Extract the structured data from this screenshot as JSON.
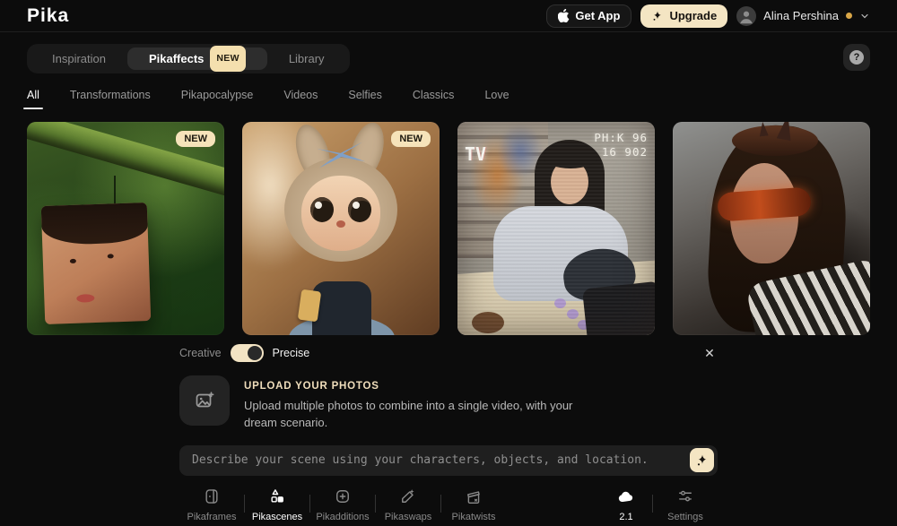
{
  "header": {
    "logo": "Pika",
    "get_app_label": "Get App",
    "upgrade_label": "Upgrade",
    "user_name": "Alina Pershina"
  },
  "tabs": {
    "items": [
      {
        "label": "Inspiration",
        "active": false
      },
      {
        "label": "Pikaffects",
        "badge": "NEW",
        "active": true
      },
      {
        "label": "Library",
        "active": false
      }
    ],
    "help_label": "?"
  },
  "filters": {
    "active": "All",
    "items": [
      "All",
      "Transformations",
      "Pikapocalypse",
      "Videos",
      "Selfies",
      "Classics",
      "Love"
    ]
  },
  "cards": [
    {
      "name": "jungle-face-cube",
      "badge": "NEW"
    },
    {
      "name": "plush-doll",
      "badge": "NEW"
    },
    {
      "name": "vhs-store-scene",
      "overlay_tv": "TV",
      "overlay_time_line1": "PH:K 96",
      "overlay_time_line2": "16 902"
    },
    {
      "name": "masked-warrior"
    }
  ],
  "mode_toggle": {
    "left_label": "Creative",
    "right_label": "Precise",
    "selected": "Precise",
    "close_label": "✕"
  },
  "upload": {
    "title": "UPLOAD YOUR PHOTOS",
    "description": "Upload multiple photos to combine into a single video, with your dream scenario."
  },
  "prompt": {
    "placeholder": "Describe your scene using your characters, objects, and location."
  },
  "bottom_nav": {
    "items": [
      {
        "label": "Pikaframes",
        "active": false
      },
      {
        "label": "Pikascenes",
        "active": true
      },
      {
        "label": "Pikadditions",
        "active": false
      },
      {
        "label": "Pikaswaps",
        "active": false
      },
      {
        "label": "Pikatwists",
        "active": false
      }
    ],
    "version": "2.1",
    "settings_label": "Settings"
  },
  "colors": {
    "accent_cream": "#f4e5c3",
    "plan_dot_yellow": "#d9a647",
    "page_background": "#0c0c0c"
  }
}
